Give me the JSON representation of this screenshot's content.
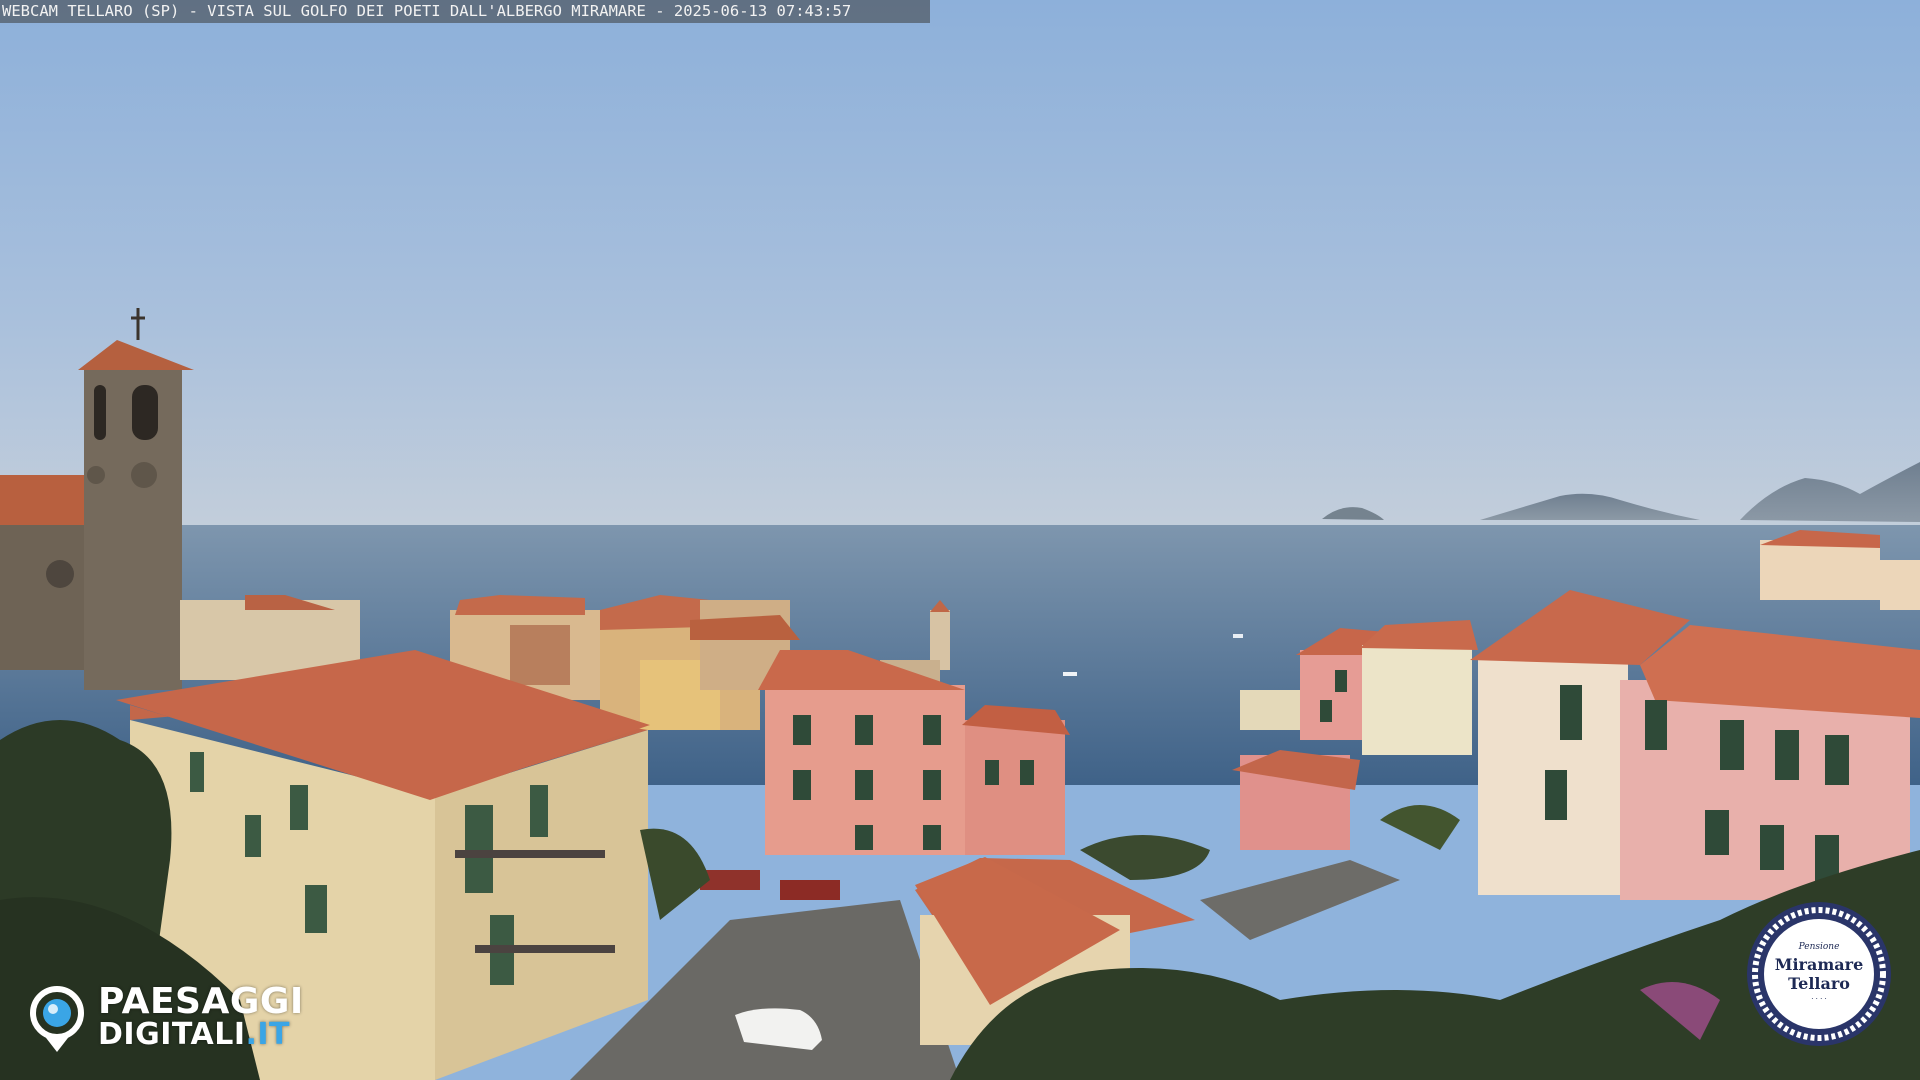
{
  "overlay": {
    "title": "WEBCAM TELLARO (SP) - VISTA SUL GOLFO DEI POETI DALL'ALBERGO MIRAMARE - 2025-06-13 07:43:57"
  },
  "logo_left": {
    "line1": "PAESAGGI",
    "line2_main": "DIGITALI",
    "line2_tld": ".IT",
    "icon": "eye-pin-icon"
  },
  "badge": {
    "small": "Pensione",
    "line1": "Miramare",
    "line2": "Tellaro",
    "tiny": "· · · ·",
    "icon": "rope-ring-badge"
  },
  "colors": {
    "sky_top": "#8fb3dc",
    "sky_bottom": "#b8c9dc",
    "sea": "#4d6f93",
    "roof": "#c9694c",
    "pink_facade": "#e79a8c",
    "accent_blue": "#3aa5e6"
  }
}
